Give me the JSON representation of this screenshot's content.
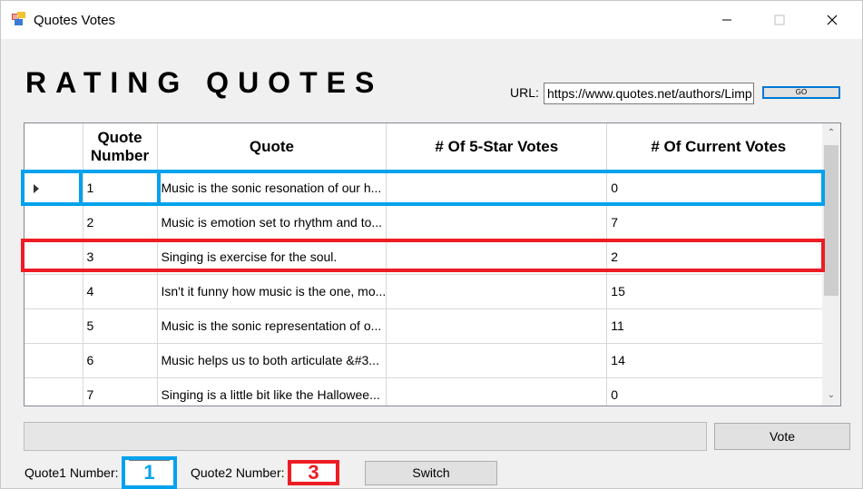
{
  "window": {
    "title": "Quotes Votes",
    "minimize_icon": "minimize-icon",
    "maximize_icon": "maximize-icon",
    "close_icon": "close-icon"
  },
  "heading": "RATING QUOTES",
  "url": {
    "label": "URL:",
    "value": "https://www.quotes.net/authors/Limp",
    "go_label": "GO"
  },
  "grid": {
    "columns": [
      "Quote Number",
      "Quote",
      "# Of 5-Star Votes",
      "# Of Current Votes"
    ],
    "rows": [
      {
        "number": "1",
        "quote": "Music is the sonic resonation of our h...",
        "five_star": "",
        "current": "0",
        "selected": true
      },
      {
        "number": "2",
        "quote": "Music is emotion set to rhythm and to...",
        "five_star": "",
        "current": "7"
      },
      {
        "number": "3",
        "quote": "Singing is exercise for the soul.",
        "five_star": "",
        "current": "2"
      },
      {
        "number": "4",
        "quote": "Isn't it funny how music is the one, mo...",
        "five_star": "",
        "current": "15"
      },
      {
        "number": "5",
        "quote": "Music is the sonic representation of o...",
        "five_star": "",
        "current": "11"
      },
      {
        "number": "6",
        "quote": "Music helps us to both articulate &#3...",
        "five_star": "",
        "current": "14"
      },
      {
        "number": "7",
        "quote": "Singing is a little bit like the Hallowee...",
        "five_star": "",
        "current": "0"
      }
    ]
  },
  "vote_label": "Vote",
  "quote1": {
    "label": "Quote1 Number:",
    "value": "1"
  },
  "quote2": {
    "label": "Quote2 Number:",
    "value": "3"
  },
  "switch_label": "Switch",
  "colors": {
    "highlight_blue": "#00a2ed",
    "highlight_red": "#ed1c24",
    "go_border": "#0078d7"
  }
}
